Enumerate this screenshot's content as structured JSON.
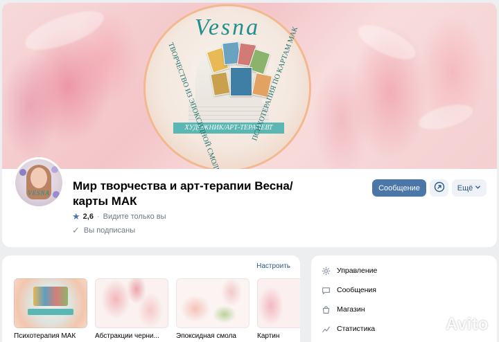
{
  "cover": {
    "badge": {
      "title": "Vesna",
      "left_arc": "ТВОРЧЕСТВО ИЗ ЭПОКСИДНОЙ СМОЛЫ",
      "right_arc": "ПСИХОТЕРАПИЯ ПО КАРТАМ МАК",
      "banner": "ХУДОЖНИК/АРТ-ТЕРАПЕВТ"
    }
  },
  "avatar": {
    "text": "VESNA"
  },
  "group": {
    "title": "Мир творчества и арт-терапии Весна/ карты МАК",
    "rating": "2,6",
    "rating_dot": "·",
    "rating_link": "Видите только вы",
    "subscribed": "Вы подписаны"
  },
  "actions": {
    "message": "Сообщение",
    "more": "Ещё",
    "share_icon": "share-arrow-icon",
    "more_icon": "chevron-down-icon"
  },
  "albums": {
    "configure": "Настроить",
    "items": [
      {
        "label": "Психотерапия МАК"
      },
      {
        "label": "Абстракции черни..."
      },
      {
        "label": "Эпоксидная смола"
      },
      {
        "label": "Картин"
      }
    ]
  },
  "menu": {
    "items": [
      {
        "label": "Управление",
        "icon": "gear-icon"
      },
      {
        "label": "Сообщения",
        "icon": "message-icon"
      },
      {
        "label": "Магазин",
        "icon": "shopping-bag-icon"
      },
      {
        "label": "Статистика",
        "icon": "chart-icon"
      }
    ]
  },
  "watermark": {
    "text": "Avito"
  },
  "colors": {
    "accent": "#4a76a8",
    "link": "#2a5885",
    "muted": "#6d7885",
    "page_bg": "#edeef0"
  }
}
